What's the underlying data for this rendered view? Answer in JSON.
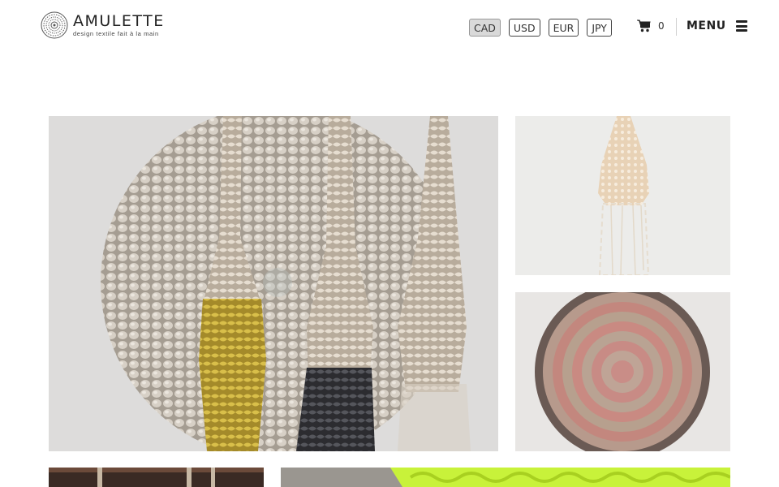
{
  "brand": {
    "name": "AMULETTE",
    "tagline": "design textile fait à la main"
  },
  "currencies": {
    "active": "CAD",
    "options": [
      "CAD",
      "USD",
      "EUR",
      "JPY"
    ]
  },
  "cart": {
    "count": "0"
  },
  "menu": {
    "label": "MENU"
  },
  "gallery": {
    "items": [
      {
        "alt": "crocheted wall hangings on beaded round rug"
      },
      {
        "alt": "cream crocheted pendant lamp"
      },
      {
        "alt": "round pink beaded rug with fringe"
      },
      {
        "alt": "hanging crochet pieces"
      },
      {
        "alt": "neon yellow chunky chain knit"
      }
    ]
  },
  "colors": {
    "accent_active_bg": "#d9d9d9",
    "text": "#222222",
    "neon": "#c8f23a"
  },
  "icons": [
    "logo-mark-icon",
    "cart-icon",
    "hamburger-icon"
  ]
}
